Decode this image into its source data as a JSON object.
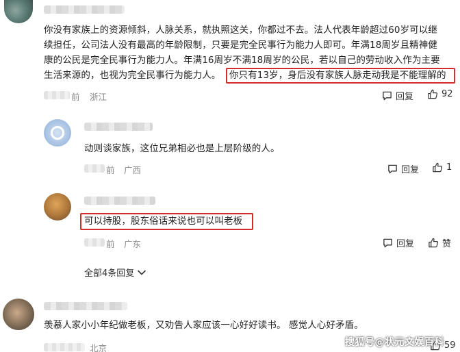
{
  "comments": [
    {
      "location": "浙江",
      "time_suffix": "前",
      "lines": [
        "你没有家族上的资源倾斜，人脉关系，就执照这关，你都过不去。法人代表年龄超过60岁可以继",
        "续担任，公司法人没有最高的年龄限制，只要是完全民事行为能力人即可。年满18周岁且精神健",
        "康的公民是完全民事行为能力人。年满16周岁不满18周岁的公民，若以自己的劳动收入作为主要",
        "生活来源的，也视为完全民事行为能力人。"
      ],
      "highlighted": "你只有13岁，身后没有家族人脉走动我是不能理解的",
      "reply_label": "回复",
      "likes": "92"
    },
    {
      "location": "广西",
      "time_suffix": "前",
      "text": "动则谈家族，这位兄弟相必也是上层阶级的人。",
      "reply_label": "回复",
      "likes": "1"
    },
    {
      "location": "广东",
      "time_suffix": "前",
      "text": "可以持股，股东俗话来说也可以叫老板",
      "reply_label": "回复",
      "likes": "赞"
    },
    {
      "location": "北京",
      "text": "羡慕人家小小年纪做老板，又劝告人家应该一心好好读书。 感觉人心好矛盾。",
      "likes": "59"
    }
  ],
  "expand_replies": "全部4条回复",
  "watermark": "搜狐号@状元文娱百科",
  "colors": {
    "highlight_border": "#d62a2a",
    "meta_text": "#8a8a8a"
  }
}
